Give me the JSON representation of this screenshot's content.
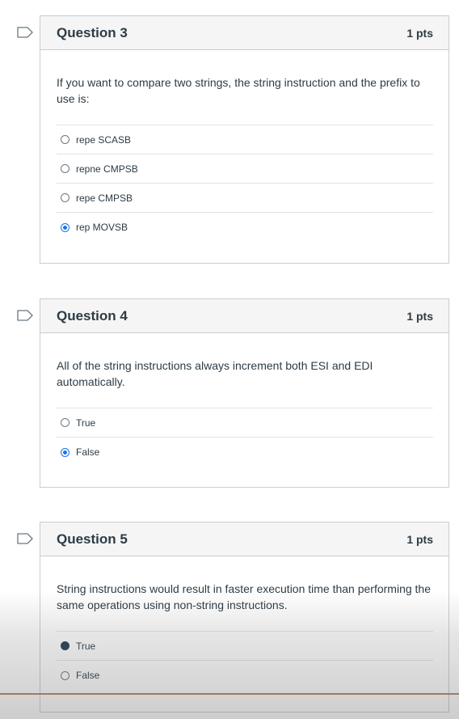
{
  "questions": [
    {
      "title": "Question 3",
      "points": "1 pts",
      "text": "If you want to compare two strings, the string instruction and the prefix to use is:",
      "options": [
        {
          "label": "repe SCASB",
          "selected": false
        },
        {
          "label": "repne CMPSB",
          "selected": false
        },
        {
          "label": "repe CMPSB",
          "selected": false
        },
        {
          "label": "rep MOVSB",
          "selected": true
        }
      ]
    },
    {
      "title": "Question 4",
      "points": "1 pts",
      "text": "All of the string instructions always increment both ESI and EDI automatically.",
      "options": [
        {
          "label": "True",
          "selected": false
        },
        {
          "label": "False",
          "selected": true
        }
      ]
    },
    {
      "title": "Question 5",
      "points": "1 pts",
      "text": "String instructions would result in faster execution time than performing the same operations using non-string instructions.",
      "options": [
        {
          "label": "True",
          "selected": true
        },
        {
          "label": "False",
          "selected": false
        }
      ]
    }
  ],
  "colors": {
    "accent": "#1a73e8",
    "border": "#c7cdd1",
    "header_bg": "#f5f5f5",
    "text": "#2d3b45"
  }
}
